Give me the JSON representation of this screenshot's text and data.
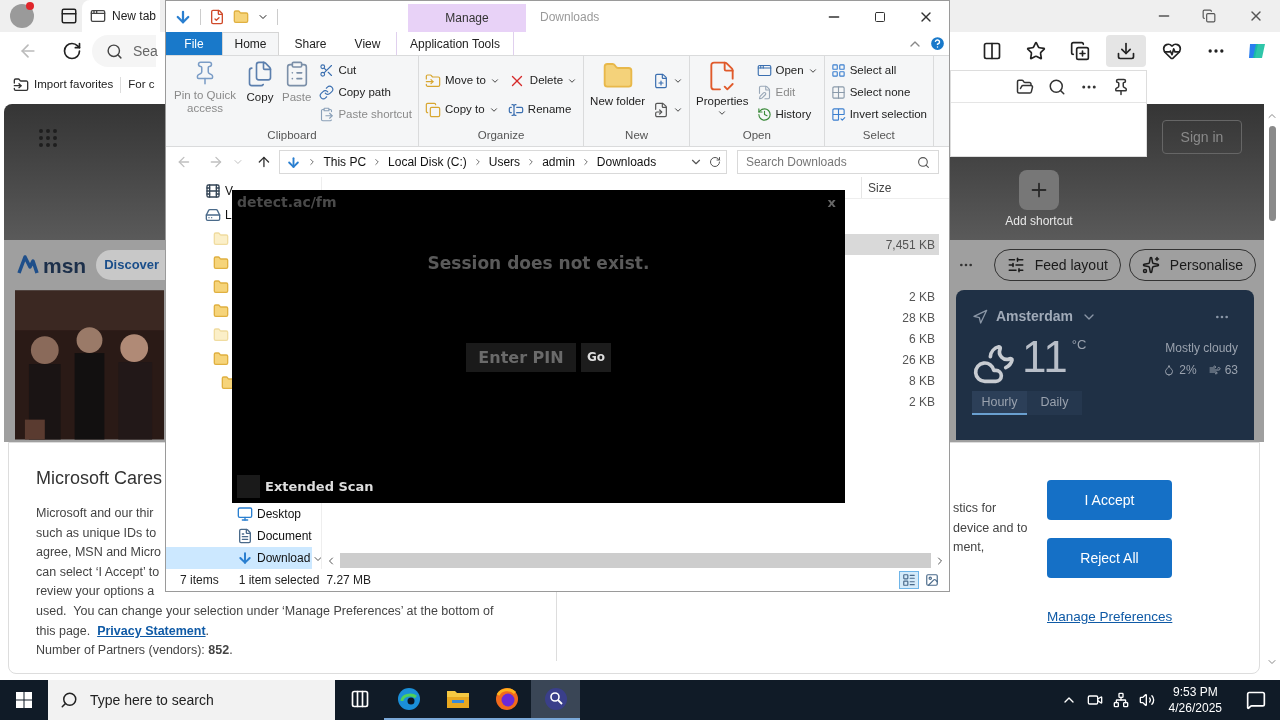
{
  "browser": {
    "tabs": [
      {
        "label": "New tab",
        "selected": true
      }
    ],
    "address_placeholder": "Sea",
    "favorites": [
      {
        "label": "Import favorites",
        "kind": "import"
      },
      {
        "label": "For c",
        "kind": "plain"
      }
    ],
    "sign_in": "Sign in",
    "add_shortcut": "Add shortcut",
    "logo": "msn",
    "discover": "Discover",
    "feed_buttons": [
      {
        "label": "Feed layout",
        "kind": "layout"
      },
      {
        "label": "Personalise",
        "kind": "personalise"
      }
    ],
    "weather": {
      "city": "Amsterdam",
      "temperature": "11",
      "unit": "°C",
      "condition": "Mostly cloudy",
      "precipitation": "2%",
      "wind": "63",
      "tabs": [
        {
          "label": "Hourly",
          "selected": true
        },
        {
          "label": "Daily",
          "selected": false
        }
      ]
    }
  },
  "consent": {
    "title": "Microsoft Cares",
    "left_lines": [
      "Microsoft and our thir",
      "such as unique IDs to",
      "agree, MSN and Micro",
      "can select ‘I Accept’ to",
      "review your options a"
    ],
    "full_line": "used.  You can change your selection under ‘Manage Preferences’ at the bottom of",
    "privacy": {
      "before": "this page.",
      "link": "Privacy Statement",
      "after": "."
    },
    "partners": "Number of Partners (vendors): **852**.",
    "right_lines": [
      "stics for",
      "device and to",
      "ment,"
    ],
    "buttons": [
      "I Accept",
      "Reject All"
    ],
    "manage_link": "Manage Preferences"
  },
  "explorer": {
    "title": "Downloads",
    "context_label": "Manage",
    "tabs": [
      {
        "label": "File",
        "kind": "file",
        "selected": false
      },
      {
        "label": "Home",
        "kind": "tab",
        "selected": true
      },
      {
        "label": "Share",
        "kind": "tab",
        "selected": false
      },
      {
        "label": "View",
        "kind": "tab",
        "selected": false
      },
      {
        "label": "Application Tools",
        "kind": "context",
        "selected": false
      }
    ],
    "ribbon": [
      {
        "label": "Clipboard",
        "large": [
          {
            "label": "Pin to Quick access",
            "kind": "pin",
            "disabled": true,
            "dropdown": false
          },
          {
            "label": "Copy",
            "kind": "copy",
            "disabled": false,
            "dropdown": false
          },
          {
            "label": "Paste",
            "kind": "paste",
            "disabled": true,
            "dropdown": false
          }
        ],
        "columns": [
          [
            {
              "label": "Cut",
              "kind": "cut",
              "disabled": false,
              "dropdown": false
            },
            {
              "label": "Copy path",
              "kind": "path",
              "disabled": false,
              "dropdown": false
            },
            {
              "label": "Paste shortcut",
              "kind": "shortcut",
              "disabled": true,
              "dropdown": false
            }
          ]
        ]
      },
      {
        "label": "Organize",
        "columns": [
          [
            {
              "label": "Move to",
              "kind": "move",
              "disabled": false,
              "dropdown": true
            },
            {
              "label": "Copy to",
              "kind": "copyto",
              "disabled": false,
              "dropdown": true
            }
          ],
          [
            {
              "label": "Delete",
              "kind": "delete",
              "disabled": false,
              "dropdown": true
            },
            {
              "label": "Rename",
              "kind": "rename",
              "disabled": false,
              "dropdown": false
            }
          ]
        ]
      },
      {
        "label": "New",
        "large": [
          {
            "label": "New folder",
            "kind": "folder",
            "disabled": false,
            "dropdown": false
          }
        ],
        "columns": [
          [
            {
              "kind": "newitem",
              "disabled": false,
              "dropdown": true
            },
            {
              "kind": "easy",
              "disabled": false,
              "dropdown": true
            }
          ]
        ]
      },
      {
        "label": "Open",
        "large": [
          {
            "label": "Properties",
            "kind": "properties",
            "disabled": false,
            "dropdown": true
          }
        ],
        "columns": [
          [
            {
              "label": "Open",
              "kind": "open",
              "disabled": false,
              "dropdown": true
            },
            {
              "label": "Edit",
              "kind": "edit",
              "disabled": true,
              "dropdown": false
            },
            {
              "label": "History",
              "kind": "history",
              "disabled": false,
              "dropdown": false
            }
          ]
        ]
      },
      {
        "label": "Select",
        "columns": [
          [
            {
              "label": "Select all",
              "kind": "selectall",
              "disabled": false,
              "dropdown": false
            },
            {
              "label": "Select none",
              "kind": "selectnone",
              "disabled": false,
              "dropdown": false
            },
            {
              "label": "Invert selection",
              "kind": "invert",
              "disabled": false,
              "dropdown": false
            }
          ]
        ]
      }
    ],
    "path": [
      "This PC",
      "Local Disk (C:)",
      "Users",
      "admin",
      "Downloads"
    ],
    "search_placeholder": "Search Downloads",
    "nav_top": [
      {
        "label": "V",
        "kind": "videos",
        "selected": false
      },
      {
        "label": "L",
        "kind": "drive",
        "selected": false,
        "children": [
          {
            "kind": "folder-pale",
            "selected": false
          },
          {
            "kind": "folder",
            "selected": false
          },
          {
            "kind": "folder",
            "selected": false
          },
          {
            "kind": "folder",
            "selected": false
          },
          {
            "kind": "folder-pale",
            "selected": false
          },
          {
            "kind": "folder",
            "selected": false,
            "children": [
              {
                "kind": "folder",
                "selected": false
              }
            ]
          }
        ]
      }
    ],
    "nav_bottom": [
      {
        "label": "Desktop",
        "kind": "desktop",
        "selected": false
      },
      {
        "label": "Document",
        "kind": "document",
        "selected": false
      },
      {
        "label": "Download",
        "kind": "download",
        "selected": true
      }
    ],
    "size_header": "Size",
    "groups": [
      {
        "rows": [
          {
            "size": "7,451 KB",
            "selected": true
          }
        ]
      },
      {
        "rows": [
          {
            "size": "2 KB",
            "selected": false
          },
          {
            "size": "28 KB",
            "selected": false
          },
          {
            "size": "6 KB",
            "selected": false
          },
          {
            "size": "26 KB",
            "selected": false
          },
          {
            "size": "8 KB",
            "selected": false
          },
          {
            "size": "2 KB",
            "selected": false
          }
        ]
      }
    ],
    "status": {
      "count": "7 items",
      "selection": "1 item selected",
      "size": "7.27 MB"
    },
    "views": [
      {
        "kind": "details",
        "selected": true
      },
      {
        "kind": "large",
        "selected": false
      }
    ]
  },
  "dialog": {
    "title": "detect.ac/fm",
    "close": "x",
    "message": "Session does not exist.",
    "pin_placeholder": "Enter PIN",
    "go": "Go",
    "extended_scan": {
      "label": "Extended Scan",
      "checked": false
    }
  },
  "taskbar": {
    "search_placeholder": "Type here to search",
    "apps": [
      {
        "kind": "taskview",
        "running": false,
        "selected": false
      },
      {
        "kind": "edge",
        "running": true,
        "selected": false
      },
      {
        "kind": "explorer",
        "running": true,
        "selected": false
      },
      {
        "kind": "firefox",
        "running": true,
        "selected": false
      },
      {
        "kind": "searchapp",
        "running": true,
        "selected": true
      }
    ],
    "time": "9:53 PM",
    "date": "4/26/2025"
  }
}
